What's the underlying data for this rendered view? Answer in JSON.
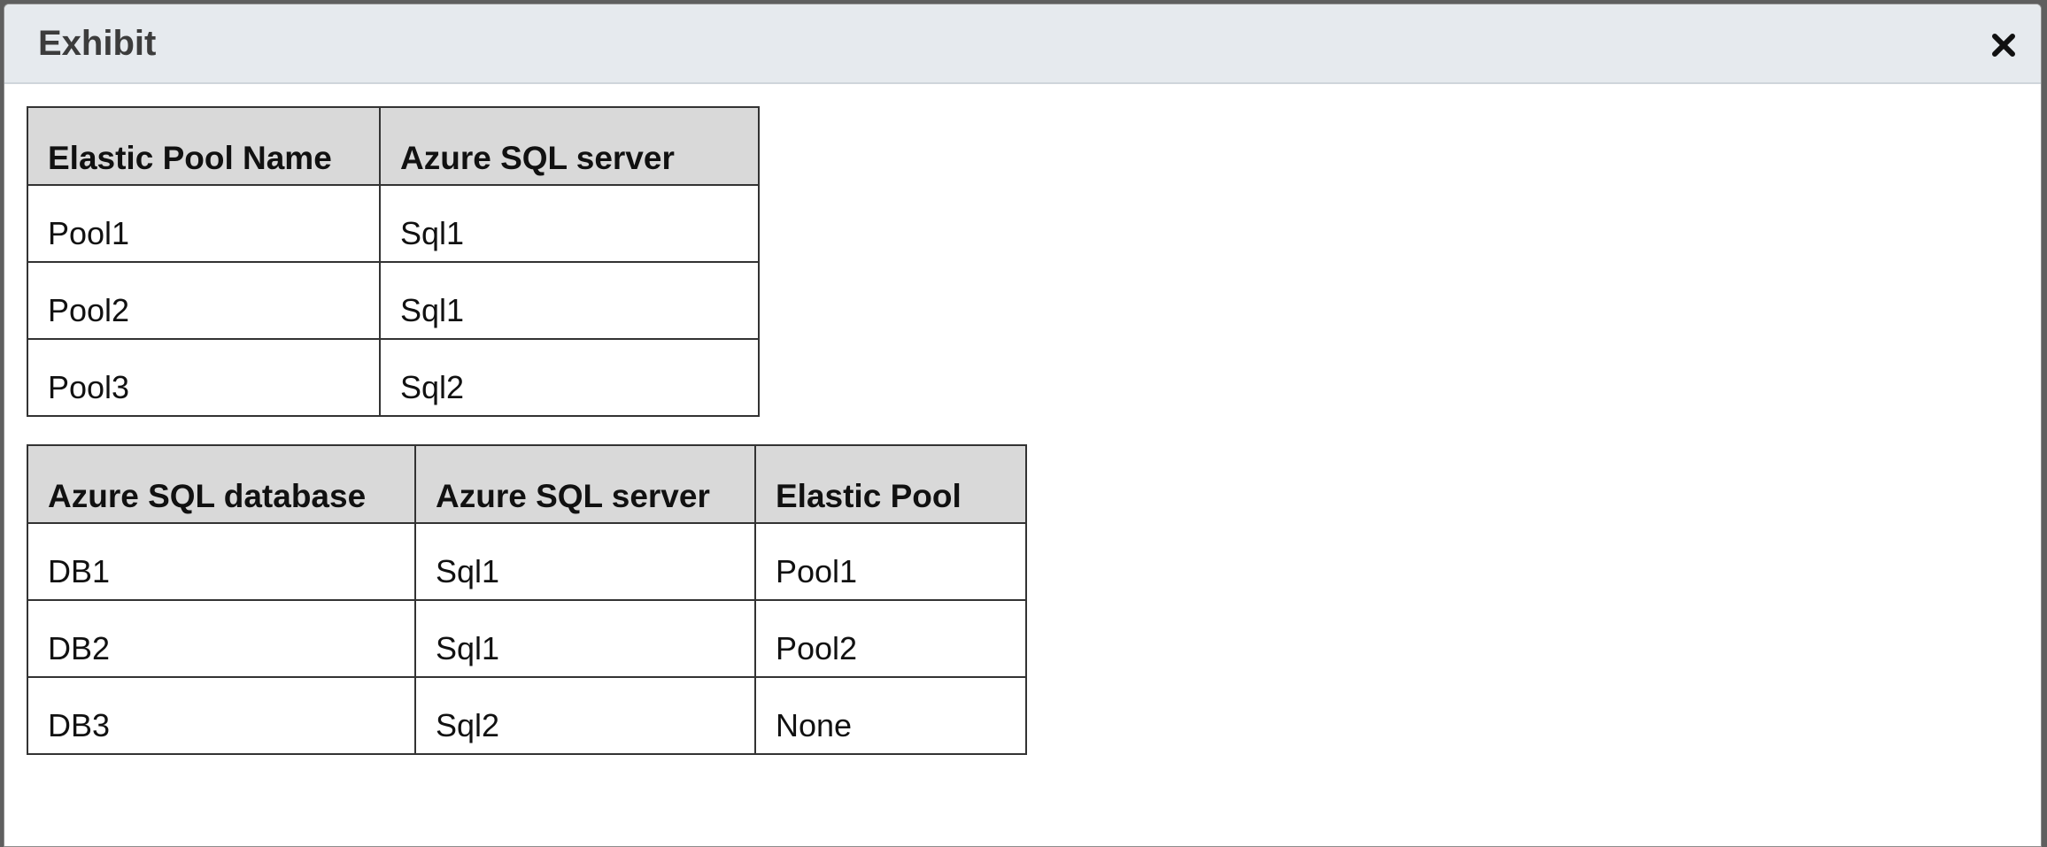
{
  "dialog": {
    "title": "Exhibit",
    "close_icon": "close-icon"
  },
  "pools_table": {
    "headers": [
      "Elastic Pool Name",
      "Azure SQL server"
    ],
    "rows": [
      [
        "Pool1",
        "Sql1"
      ],
      [
        "Pool2",
        "Sql1"
      ],
      [
        "Pool3",
        "Sql2"
      ]
    ]
  },
  "databases_table": {
    "headers": [
      "Azure SQL database",
      "Azure SQL server",
      "Elastic Pool"
    ],
    "rows": [
      [
        "DB1",
        "Sql1",
        "Pool1"
      ],
      [
        "DB2",
        "Sql1",
        "Pool2"
      ],
      [
        "DB3",
        "Sql2",
        "None"
      ]
    ]
  },
  "colors": {
    "header_bar": "#e6eaee",
    "table_header_fill": "#d9d9d9",
    "border": "#333333"
  }
}
